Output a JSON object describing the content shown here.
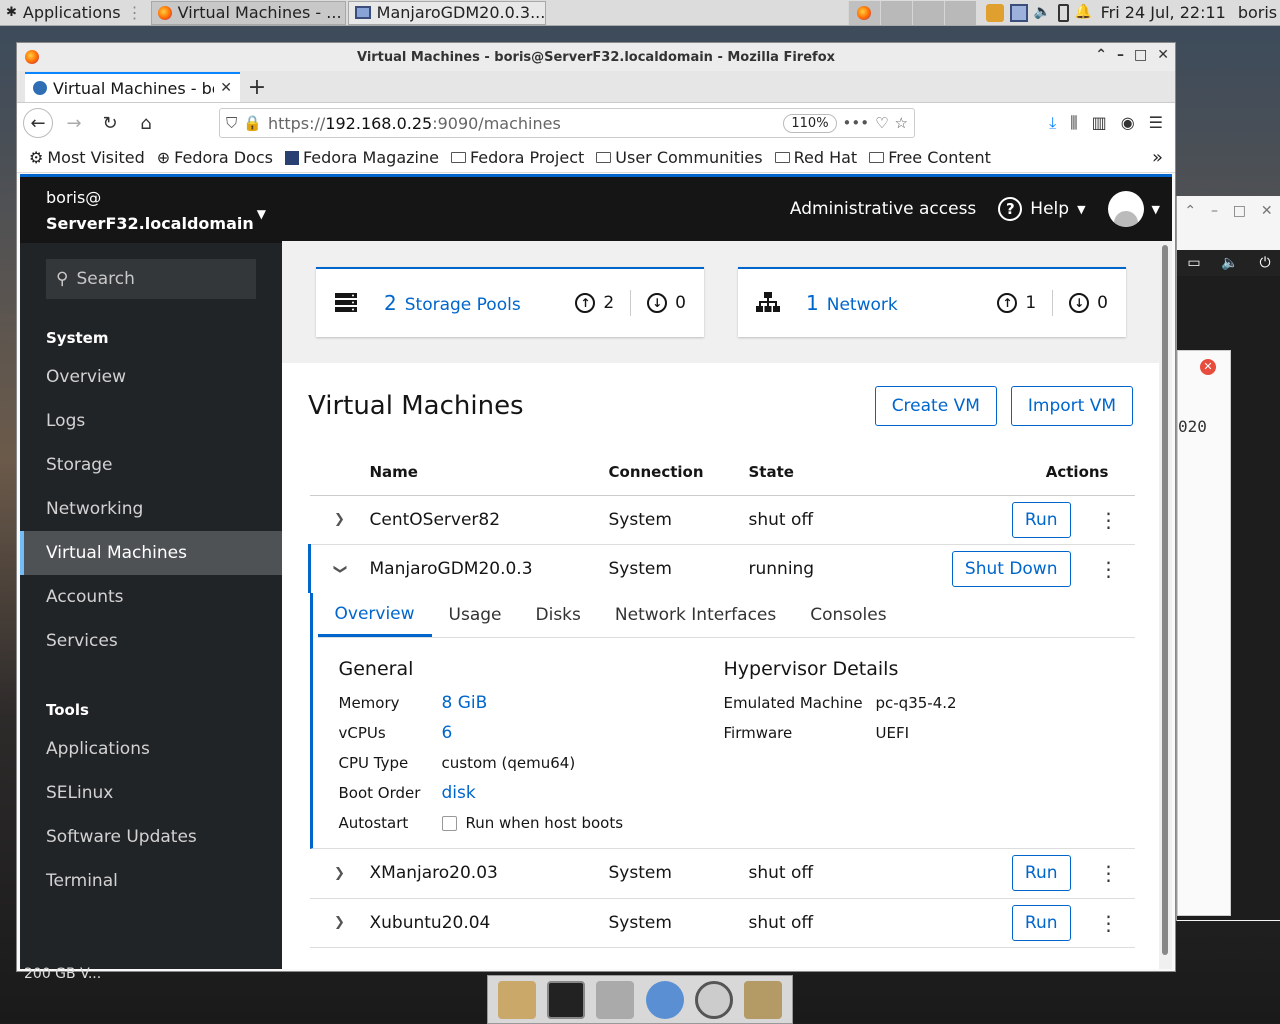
{
  "panel": {
    "apps_label": "Applications",
    "tasks": [
      {
        "label": "Virtual Machines - ..."
      },
      {
        "label": "ManjaroGDM20.0.3..."
      }
    ],
    "clock": "Fri 24 Jul, 22:11",
    "user": "boris"
  },
  "bgwin": {
    "text": "020"
  },
  "firefox": {
    "window_title": "Virtual Machines - boris@ServerF32.localdomain - Mozilla Firefox",
    "tab_title": "Virtual Machines - bo",
    "url_prefix": "https://",
    "url_host": "192.168.0.25",
    "url_path": ":9090/machines",
    "zoom": "110%",
    "bookmarks": [
      "Most Visited",
      "Fedora Docs",
      "Fedora Magazine",
      "Fedora Project",
      "User Communities",
      "Red Hat",
      "Free Content"
    ]
  },
  "cockpit": {
    "host_user": "boris@",
    "host_name": "ServerF32.localdomain",
    "search_placeholder": "Search",
    "system_heading": "System",
    "system_items": [
      "Overview",
      "Logs",
      "Storage",
      "Networking",
      "Virtual Machines",
      "Accounts",
      "Services"
    ],
    "tools_heading": "Tools",
    "tools_items": [
      "Applications",
      "SELinux",
      "Software Updates",
      "Terminal"
    ],
    "masthead": {
      "admin": "Administrative access",
      "help": "Help"
    },
    "cards": [
      {
        "count": "2",
        "label": "Storage Pools",
        "up": "2",
        "down": "0"
      },
      {
        "count": "1",
        "label": "Network",
        "up": "1",
        "down": "0"
      }
    ],
    "vm_title": "Virtual Machines",
    "create_vm": "Create VM",
    "import_vm": "Import VM",
    "columns": {
      "name": "Name",
      "connection": "Connection",
      "state": "State",
      "actions": "Actions"
    },
    "vms": [
      {
        "name": "CentOServer82",
        "connection": "System",
        "state": "shut off",
        "action": "Run"
      },
      {
        "name": "ManjaroGDM20.0.3",
        "connection": "System",
        "state": "running",
        "action": "Shut Down"
      },
      {
        "name": "XManjaro20.03",
        "connection": "System",
        "state": "shut off",
        "action": "Run"
      },
      {
        "name": "Xubuntu20.04",
        "connection": "System",
        "state": "shut off",
        "action": "Run"
      }
    ],
    "detail": {
      "tabs": [
        "Overview",
        "Usage",
        "Disks",
        "Network Interfaces",
        "Consoles"
      ],
      "general_heading": "General",
      "memory_label": "Memory",
      "memory": "8 GiB",
      "vcpus_label": "vCPUs",
      "vcpus": "6",
      "cputype_label": "CPU Type",
      "cputype": "custom (qemu64)",
      "boot_label": "Boot Order",
      "boot": "disk",
      "autostart_label": "Autostart",
      "autostart": "Run when host boots",
      "hyper_heading": "Hypervisor Details",
      "machine_label": "Emulated Machine",
      "machine": "pc-q35-4.2",
      "firmware_label": "Firmware",
      "firmware": "UEFI"
    }
  },
  "desktop": {
    "left_text": "200 GB V..."
  }
}
